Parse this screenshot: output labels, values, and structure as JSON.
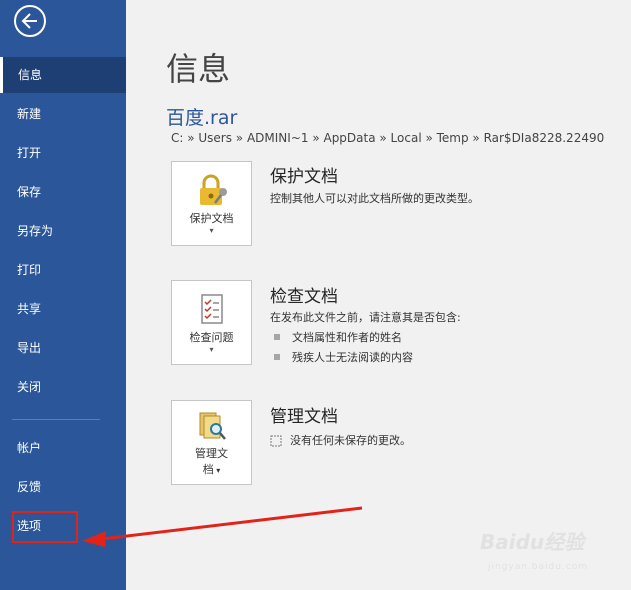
{
  "nav": {
    "items": [
      {
        "label": "信息",
        "active": true
      },
      {
        "label": "新建"
      },
      {
        "label": "打开"
      },
      {
        "label": "保存"
      },
      {
        "label": "另存为"
      },
      {
        "label": "打印"
      },
      {
        "label": "共享"
      },
      {
        "label": "导出"
      },
      {
        "label": "关闭"
      },
      {
        "label": "帐户"
      },
      {
        "label": "反馈"
      },
      {
        "label": "选项"
      }
    ]
  },
  "main": {
    "title": "信息",
    "file_name": "百度.rar",
    "file_path": "C: » Users » ADMINI~1 » AppData » Local » Temp » Rar$DIa8228.22490",
    "protect": {
      "button": "保护文档",
      "title": "保护文档",
      "desc": "控制其他人可以对此文档所做的更改类型。"
    },
    "inspect": {
      "button": "检查问题",
      "title": "检查文档",
      "desc": "在发布此文件之前，请注意其是否包含:",
      "bullets": [
        "文档属性和作者的姓名",
        "残疾人士无法阅读的内容"
      ]
    },
    "manage": {
      "button_line1": "管理文",
      "button_line2": "档",
      "title": "管理文档",
      "desc": "没有任何未保存的更改。"
    }
  },
  "watermark": {
    "text": "Baidu经验",
    "url": "jingyan.baidu.com"
  },
  "colors": {
    "sidebar": "#2b579a",
    "accent_red": "#e2231a",
    "background": "#f1f1f1"
  }
}
